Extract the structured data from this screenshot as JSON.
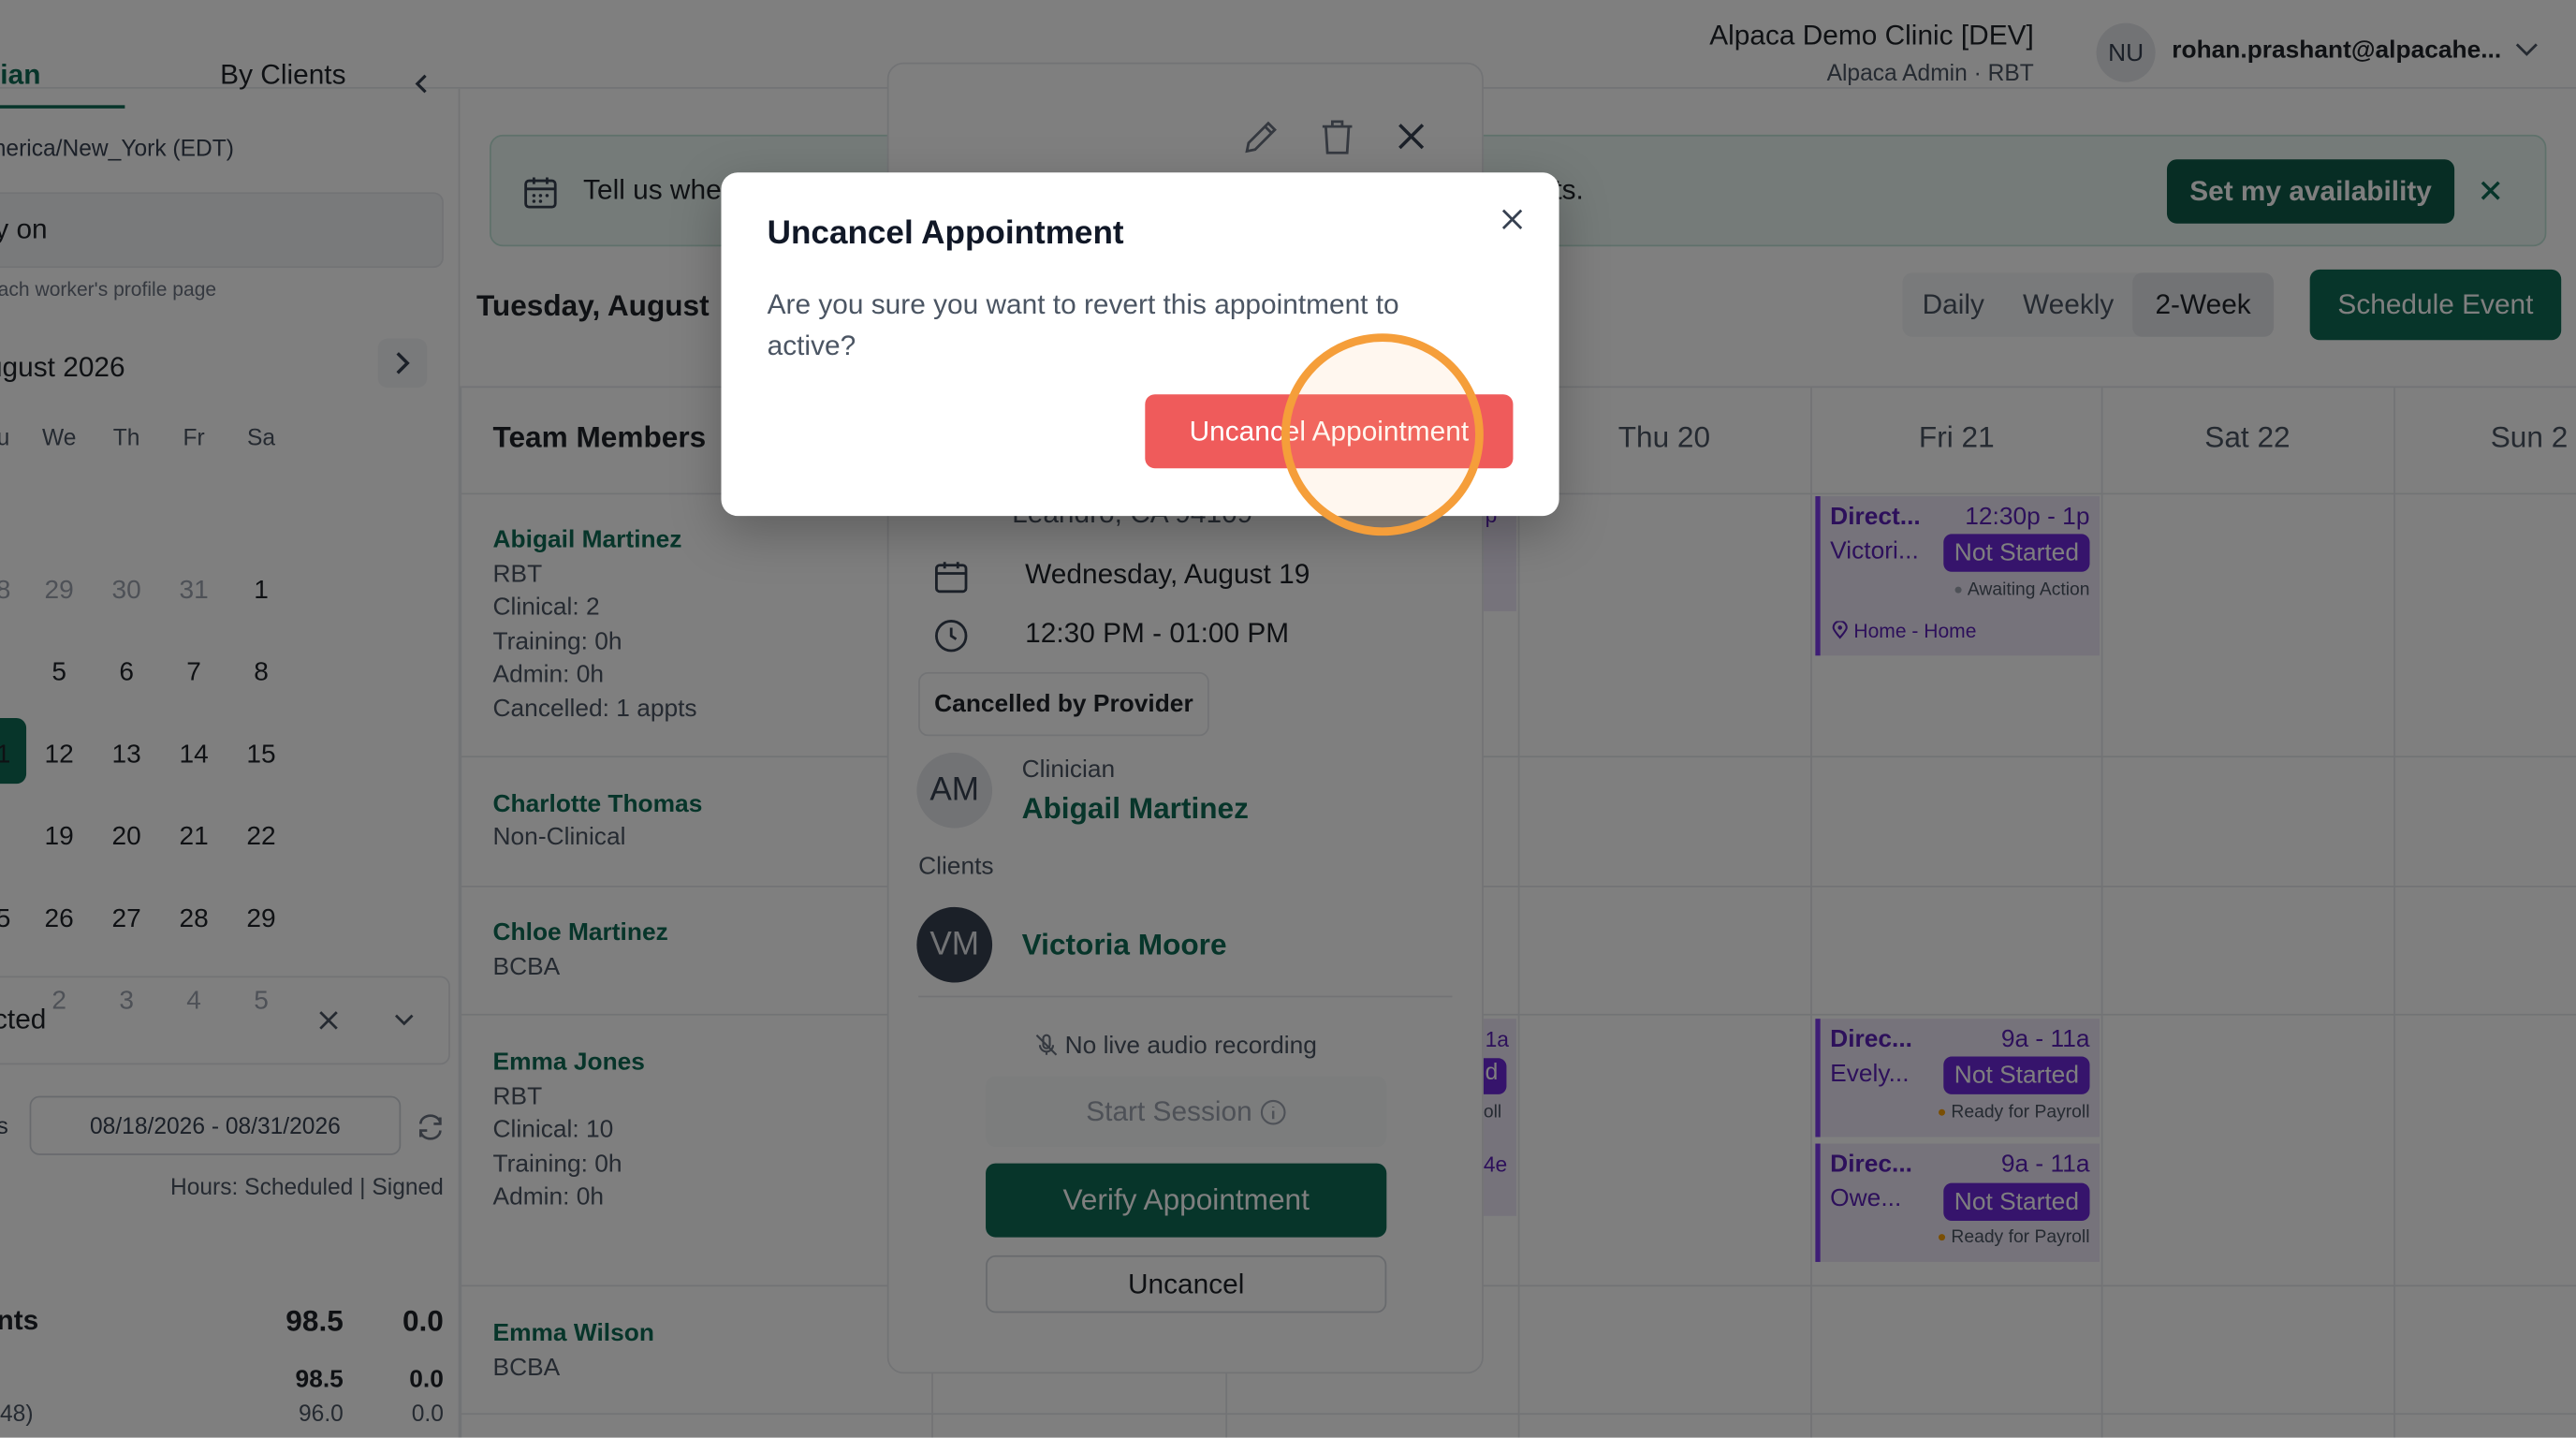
{
  "header": {
    "clinic_name": "Alpaca Demo Clinic [DEV]",
    "clinic_role": "Alpaca Admin · RBT",
    "user_initials": "NU",
    "user_email": "rohan.prashant@alpacahe..."
  },
  "sidebar": {
    "tab_clinician": "ician",
    "tab_clients": "By Clients",
    "timezone": "merica/New_York (EDT)",
    "availability_text": "ty on",
    "availability_hint": "each worker's profile page",
    "month_label": "ugust 2026",
    "weekdays": [
      "u",
      "We",
      "Th",
      "Fr",
      "Sa"
    ],
    "calendar_rows": [
      [
        "8",
        "29",
        "30",
        "31",
        "1"
      ],
      [
        "",
        "5",
        "6",
        "7",
        "8"
      ],
      [
        "1",
        "12",
        "13",
        "14",
        "15"
      ],
      [
        "8",
        "19",
        "20",
        "21",
        "22"
      ],
      [
        "5",
        "26",
        "27",
        "28",
        "29"
      ],
      [
        "",
        "2",
        "3",
        "4",
        "5"
      ]
    ],
    "filter_text": "cted",
    "range_prefix": "s",
    "date_range": "08/18/2026 - 08/31/2026",
    "hours_header": "Hours:  Scheduled | Signed",
    "stats": [
      {
        "label": "nts",
        "scheduled": "98.5",
        "signed": "0.0"
      },
      {
        "label": "",
        "scheduled": "98.5",
        "signed": "0.0"
      },
      {
        "label": "48)",
        "scheduled": "96.0",
        "signed": "0.0"
      }
    ]
  },
  "banner": {
    "text": "Tell us whe",
    "tail": "ts.",
    "action_label": "Set my availability"
  },
  "toolbar": {
    "date_title": "Tuesday, August",
    "views": [
      "Daily",
      "Weekly",
      "2-Week"
    ],
    "active_view": "2-Week",
    "schedule_label": "Schedule Event"
  },
  "grid": {
    "team_header": "Team Members",
    "days": [
      "Thu 20",
      "Fri 21",
      "Sat 22",
      "Sun 2"
    ],
    "members": [
      {
        "name": "Abigail Martinez",
        "lines": [
          "RBT",
          "Clinical: 2",
          "Training: 0h",
          "Admin: 0h",
          "Cancelled: 1 appts"
        ]
      },
      {
        "name": "Charlotte Thomas",
        "lines": [
          "Non-Clinical"
        ]
      },
      {
        "name": "Chloe Martinez",
        "lines": [
          "BCBA"
        ]
      },
      {
        "name": "Emma Jones",
        "lines": [
          "RBT",
          "Clinical: 10",
          "Training: 0h",
          "Admin: 0h"
        ]
      },
      {
        "name": "Emma Wilson",
        "lines": [
          "BCBA"
        ]
      }
    ],
    "events": [
      {
        "title": "Direct...",
        "time": "12:30p - 1p",
        "client": "Victori...",
        "badge": "Not Started",
        "status": "Awaiting Action",
        "status_color": "#9ca3af",
        "location": "Home - Home"
      },
      {
        "title": "Direc...",
        "time": "9a - 11a",
        "client": "Evely...",
        "badge": "Not Started",
        "status": "Ready for Payroll",
        "status_color": "#f59e0b"
      },
      {
        "title": "Direc...",
        "time": "9a - 11a",
        "client": "Owe...",
        "badge": "Not Started",
        "status": "Ready for Payroll",
        "status_color": "#f59e0b"
      }
    ],
    "peek_texts": [
      "p",
      "1a",
      "d",
      "oll",
      "4e"
    ]
  },
  "panel": {
    "address": "Leandro, CA 94109",
    "date": "Wednesday, August 19",
    "time": "12:30 PM - 01:00 PM",
    "cancel_tag": "Cancelled by Provider",
    "clinician_label": "Clinician",
    "clinician_initials": "AM",
    "clinician_name": "Abigail Martinez",
    "clients_label": "Clients",
    "client_initials": "VM",
    "client_name": "Victoria Moore",
    "no_audio": "No live audio recording",
    "start_label": "Start Session",
    "verify_label": "Verify Appointment",
    "uncancel_label": "Uncancel"
  },
  "modal": {
    "title": "Uncancel Appointment",
    "body": "Are you sure you want to revert this appointment to active?",
    "confirm_label": "Uncancel Appointment"
  },
  "colors": {
    "brand": "#0f6b55",
    "danger": "#ef5b5b",
    "event_purple": "#6d28d9",
    "cursor_ring": "#f59e3a"
  }
}
